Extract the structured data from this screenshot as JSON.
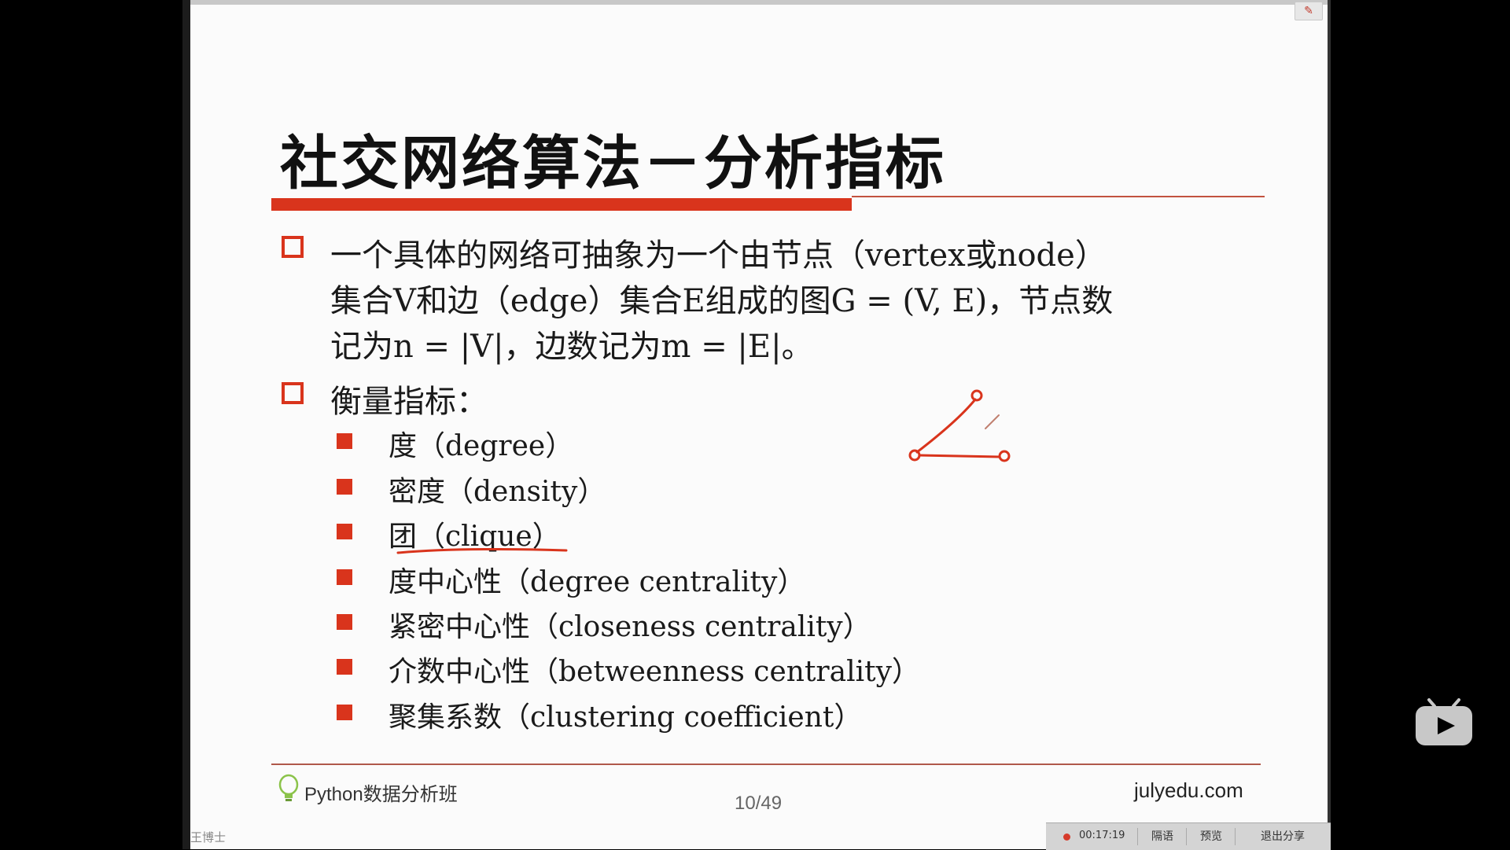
{
  "slide": {
    "title": "社交网络算法－分析指标",
    "bullet1": {
      "line1": "一个具体的网络可抽象为一个由节点（vertex或node）",
      "line2": "集合V和边（edge）集合E组成的图G = (V, E)，节点数",
      "line3": "记为n = |V|，边数记为m = |E|。"
    },
    "bullet2": "衡量指标：",
    "metrics": [
      "度（degree）",
      "密度（density）",
      "团（clique）",
      "度中心性（degree centrality）",
      "紧密中心性（closeness centrality）",
      "介数中心性（betweenness centrality）",
      "聚集系数（clustering coefficient）"
    ]
  },
  "footer": {
    "brand": "Python数据分析班",
    "page": "10/49",
    "site": "julyedu.com"
  },
  "presenter": {
    "name": "王博士"
  },
  "control_bar": {
    "timer": "00:17:19",
    "btn_comment": "隔语",
    "btn_preview": "预览",
    "btn_exit": "退出分享"
  },
  "colors": {
    "accent": "#d9341c",
    "annotation": "#d9341c",
    "slide_bg": "#fbfbfb"
  }
}
